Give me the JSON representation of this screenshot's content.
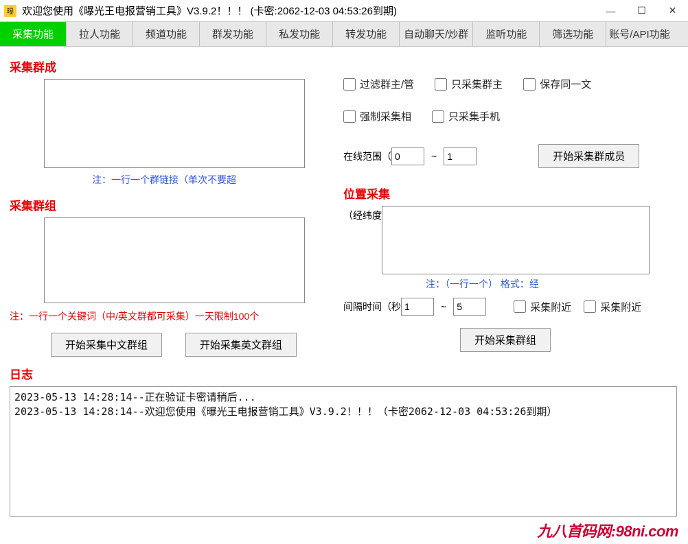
{
  "window": {
    "title": "欢迎您使用《曝光王电报营销工具》V3.9.2！！！ (卡密:2062-12-03 04:53:26到期)"
  },
  "tabs": [
    "采集功能",
    "拉人功能",
    "频道功能",
    "群发功能",
    "私发功能",
    "转发功能",
    "自动聊天/炒群",
    "监听功能",
    "筛选功能",
    "账号/API功能"
  ],
  "collectGroupMembers": {
    "title": "采集群成",
    "note": "注：一行一个群链接（单次不要超",
    "checks": {
      "filterAdmin": "过滤群主/管",
      "onlyAdmin": "只采集群主",
      "saveSame": "保存同一文",
      "forceCollect": "强制采集相",
      "onlyMobile": "只采集手机"
    },
    "onlineRangeLabel": "在线范围（",
    "onlineFrom": "0",
    "tilde": "~",
    "onlineTo": "1",
    "startBtn": "开始采集群成员"
  },
  "collectGroupKeywords": {
    "title": "采集群组",
    "note": "注：一行一个关键词（中/英文群都可采集）一天限制100个",
    "startZhBtn": "开始采集中文群组",
    "startEnBtn": "开始采集英文群组"
  },
  "locationCollect": {
    "title": "位置采集",
    "latLonLabel": "（经纬度",
    "formatNote": "注：（一行一个） 格式：经",
    "intervalLabel": "间隔时间（秒",
    "intervalFrom": "1",
    "tilde": "~",
    "intervalTo": "5",
    "chkAttach1": "采集附近",
    "chkAttach2": "采集附近",
    "startBtn": "开始采集群组"
  },
  "log": {
    "title": "日志",
    "lines": [
      "2023-05-13 14:28:14--正在验证卡密请稍后...",
      "2023-05-13 14:28:14--欢迎您使用《曝光王电报营销工具》V3.9.2！！！（卡密2062-12-03 04:53:26到期）"
    ]
  },
  "watermark": "九八首码网:98ni.com"
}
